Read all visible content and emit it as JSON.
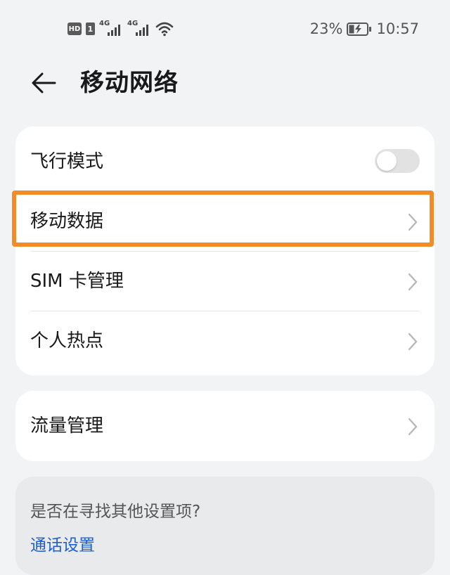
{
  "status_bar": {
    "hd_label": "HD",
    "sim_label": "1",
    "network_1": "4G",
    "network_2": "4G",
    "battery_percent": "23%",
    "time": "10:57"
  },
  "header": {
    "title": "移动网络"
  },
  "card_main": {
    "airplane_label": "飞行模式",
    "airplane_enabled": false,
    "mobile_data_label": "移动数据",
    "sim_label": "SIM 卡管理",
    "hotspot_label": "个人热点"
  },
  "card_traffic": {
    "traffic_label": "流量管理"
  },
  "suggestions": {
    "title": "是否在寻找其他设置项?",
    "link": "通话设置"
  },
  "colors": {
    "highlight": "#f28c28",
    "link": "#1a5fd6",
    "background": "#f1f3f5"
  }
}
